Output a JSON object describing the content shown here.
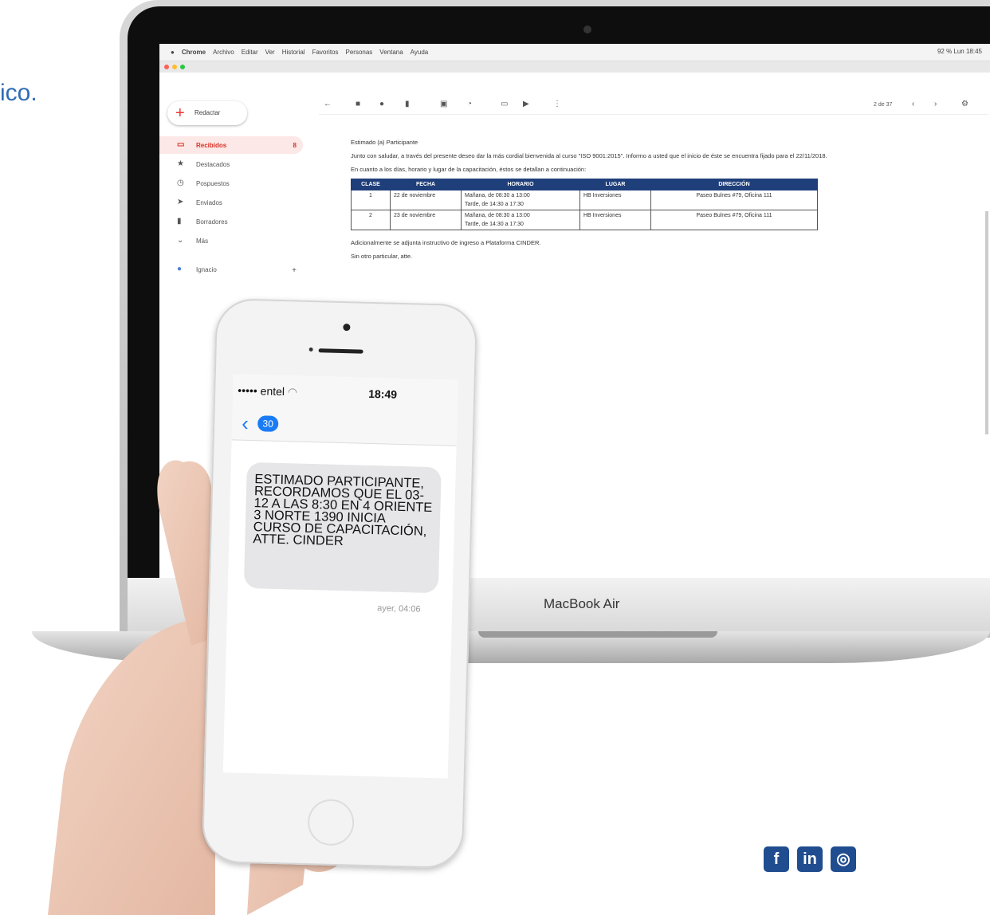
{
  "heading_fragment": "ico.",
  "laptop": {
    "brand": "MacBook Air"
  },
  "menubar": {
    "apple": "",
    "items": [
      "Chrome",
      "Archivo",
      "Editar",
      "Ver",
      "Historial",
      "Favoritos",
      "Personas",
      "Ventana",
      "Ayuda"
    ],
    "status": "92 %  Lun 18:45"
  },
  "gmail": {
    "compose": "Redactar",
    "sidebar": [
      {
        "label": "Recibidos",
        "count": "8",
        "icon": "inbox-icon"
      },
      {
        "label": "Destacados",
        "icon": "star-icon"
      },
      {
        "label": "Pospuestos",
        "icon": "clock-icon"
      },
      {
        "label": "Enviados",
        "icon": "send-icon"
      },
      {
        "label": "Borradores",
        "icon": "draft-icon"
      },
      {
        "label": "Más",
        "icon": "chevron-down-icon"
      },
      {
        "label": "Ignacio",
        "icon": "avatar"
      }
    ],
    "pager": "2 de 37",
    "message": {
      "greeting": "Estimado (a) Participante",
      "intro": "Junto con saludar, a través del presente deseo dar la más cordial bienvenida al curso \"ISO 9001:2015\". Informo a usted que el inicio de éste se encuentra fijado para el 22/11/2018.",
      "details": "En cuanto a los días, horario y lugar de la capacitación, éstos se detallan a continuación:",
      "table": {
        "headers": [
          "CLASE",
          "FECHA",
          "HORARIO",
          "LUGAR",
          "DIRECCIÓN"
        ],
        "rows": [
          [
            "1",
            "22 de noviembre",
            "Mañana, de 08:30 a 13:00\nTarde, de 14:30 a 17:30",
            "HB Inversiones",
            "Paseo Bulnes #79, Oficina 111"
          ],
          [
            "2",
            "23 de noviembre",
            "Mañana, de 08:30 a 13:00\nTarde, de 14:30 a 17:30",
            "HB Inversiones",
            "Paseo Bulnes #79, Oficina 111"
          ]
        ]
      },
      "attachment": "Adicionalmente se adjunta instructivo de ingreso a Plataforma CINDER.",
      "closing": "Sin otro particular, atte."
    }
  },
  "phone": {
    "carrier": "••••• entel",
    "time": "18:49",
    "back_badge": "30",
    "message": "ESTIMADO PARTICIPANTE, RECORDAMOS QUE EL 03-12 A LAS 8:30 EN 4 ORIENTE 3 NORTE 1390 INICIA CURSO DE CAPACITACIÓN, ATTE. CINDER",
    "timestamp": "ayer, 04:06"
  },
  "social": [
    "f",
    "in",
    "◎"
  ]
}
